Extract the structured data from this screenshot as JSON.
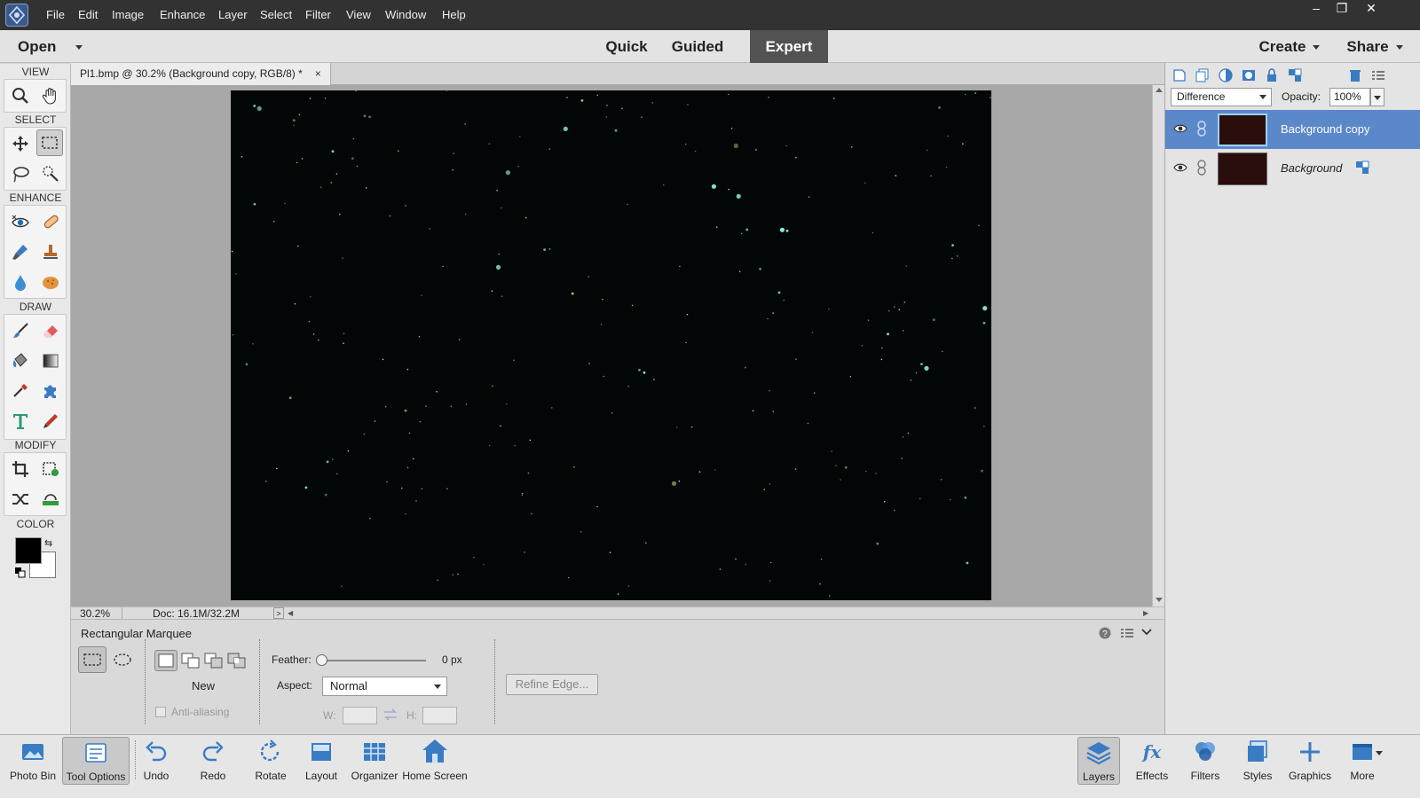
{
  "app": {
    "menu": [
      "File",
      "Edit",
      "Image",
      "Enhance",
      "Layer",
      "Select",
      "Filter",
      "View",
      "Window",
      "Help"
    ],
    "window_controls": [
      "–",
      "❐",
      "✕"
    ]
  },
  "modebar": {
    "open_label": "Open",
    "modes": [
      "Quick",
      "Guided",
      "Expert"
    ],
    "active_mode": "Expert",
    "create_label": "Create",
    "share_label": "Share"
  },
  "toolbox": {
    "sections": [
      "VIEW",
      "SELECT",
      "ENHANCE",
      "DRAW",
      "MODIFY",
      "COLOR"
    ],
    "active_tool": "rectangular-marquee-tool",
    "foreground_color": "#000000",
    "background_color": "#ffffff"
  },
  "document": {
    "tab_title": "Pl1.bmp @ 30.2% (Background copy, RGB/8) *",
    "tab_close": "×",
    "zoom": "30.2%",
    "doc_size": "Doc: 16.1M/32.2M"
  },
  "tool_options": {
    "tool_name": "Rectangular Marquee",
    "new_label": "New",
    "anti_alias_label": "Anti-aliasing",
    "anti_alias_checked": false,
    "feather_label": "Feather:",
    "feather_value": "0 px",
    "aspect_label": "Aspect:",
    "aspect_value": "Normal",
    "width_label": "W:",
    "height_label": "H:",
    "refine_edge_label": "Refine Edge..."
  },
  "layers_panel": {
    "blend_mode": "Difference",
    "opacity_label": "Opacity:",
    "opacity_value": "100%",
    "layers": [
      {
        "name": "Background copy",
        "visible": true,
        "selected": true
      },
      {
        "name": "Background",
        "visible": true,
        "selected": false,
        "locked": true
      }
    ]
  },
  "taskbar": {
    "left": [
      "Photo Bin",
      "Tool Options",
      "Undo",
      "Redo",
      "Rotate",
      "Layout",
      "Organizer",
      "Home Screen"
    ],
    "right": [
      "Layers",
      "Effects",
      "Filters",
      "Styles",
      "Graphics",
      "More"
    ],
    "active_left": "Tool Options",
    "active_right": "Layers"
  },
  "colors": {
    "accent_selected_layer": "#5b88c8",
    "menubar_bg": "#323232",
    "canvas_bg": "#030606",
    "star_color": "#8fe8e4"
  }
}
